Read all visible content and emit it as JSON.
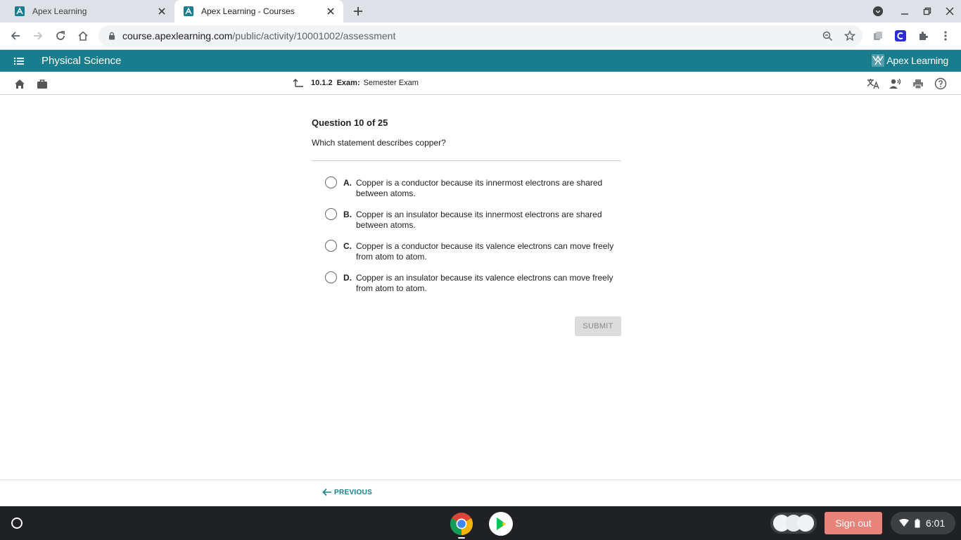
{
  "browser": {
    "tabs": [
      {
        "title": "Apex Learning",
        "favicon": "apex-favicon"
      },
      {
        "title": "Apex Learning - Courses",
        "favicon": "apex-favicon"
      }
    ],
    "url_host": "course.apexlearning.com",
    "url_path": "/public/activity/10001002/assessment"
  },
  "apex": {
    "course_title": "Physical Science",
    "logo_text": "Apex Learning",
    "brand_color": "#197d8d"
  },
  "breadcrumb": {
    "number": "10.1.2",
    "type": "Exam:",
    "name": "Semester Exam"
  },
  "question": {
    "number_label": "Question 10 of 25",
    "prompt": "Which statement describes copper?",
    "options": [
      {
        "letter": "A.",
        "text": "Copper is a conductor because its innermost electrons are shared between atoms."
      },
      {
        "letter": "B.",
        "text": "Copper is an insulator because its innermost electrons are shared between atoms."
      },
      {
        "letter": "C.",
        "text": "Copper is a conductor because its valence electrons can move freely from atom to atom."
      },
      {
        "letter": "D.",
        "text": "Copper is an insulator because its valence electrons can move freely from atom to atom."
      }
    ],
    "submit_label": "SUBMIT"
  },
  "footer": {
    "previous_label": "PREVIOUS"
  },
  "shelf": {
    "signout_label": "Sign out",
    "time": "6:01"
  }
}
